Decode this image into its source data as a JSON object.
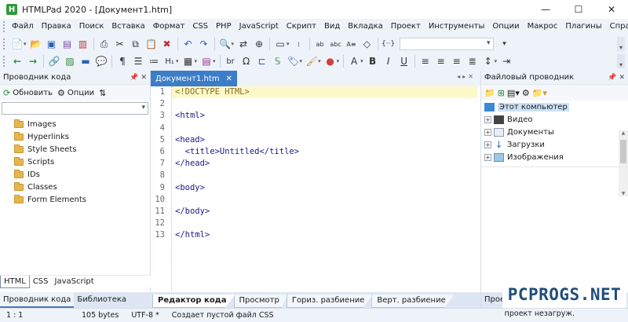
{
  "window": {
    "title": "HTMLPad 2020 - [Документ1.htm]",
    "buttons": {
      "minimize": "—",
      "maximize": "☐",
      "close": "✕"
    }
  },
  "menu": [
    "Файл",
    "Правка",
    "Поиск",
    "Вставка",
    "Формат",
    "CSS",
    "PHP",
    "JavaScript",
    "Скрипт",
    "Вид",
    "Вкладка",
    "Проект",
    "Инструменты",
    "Опции",
    "Макрос",
    "Плагины",
    "Справка"
  ],
  "toolbar1_icons": [
    "new-file-icon",
    "open-icon",
    "save-icon",
    "print-icon",
    "cut-icon",
    "copy-icon",
    "paste-icon",
    "undo-icon",
    "redo-icon",
    "find-icon",
    "replace-icon",
    "zoom-icon",
    "spell-icon",
    "format-icon",
    "snippet-icon"
  ],
  "toolbar2_icons": [
    "back-icon",
    "forward-icon",
    "link-icon",
    "image-icon",
    "rule-icon",
    "comment-icon",
    "paragraph-icon",
    "list-icon",
    "numbered-list-icon",
    "heading-icon",
    "table-icon",
    "form-icon",
    "break-icon",
    "omega-icon",
    "script-icon",
    "tag-icon",
    "brush-icon",
    "color-icon",
    "font-color-icon",
    "bold-icon",
    "italic-icon",
    "underline-icon",
    "align-left-icon",
    "align-center-icon",
    "align-right-icon",
    "justify-icon",
    "line-height-icon",
    "indent-icon"
  ],
  "left_panel": {
    "title": "Проводник кода",
    "refresh_label": "Обновить",
    "options_label": "Опции",
    "search_placeholder": "",
    "items": [
      "Images",
      "Hyperlinks",
      "Style Sheets",
      "Scripts",
      "IDs",
      "Classes",
      "Form Elements"
    ],
    "lang_tabs": [
      "HTML",
      "CSS",
      "JavaScript"
    ],
    "active_lang_tab": "HTML",
    "panel_tabs": [
      "Проводник кода",
      "Библиотека"
    ]
  },
  "editor": {
    "tab_title": "Документ1.htm",
    "close_glyph": "✕",
    "line_numbers": [
      "1",
      "2",
      "3",
      "4",
      "5",
      "6",
      "7",
      "8",
      "9",
      "10",
      "11",
      "12",
      "13"
    ],
    "lines": [
      "<!DOCTYPE HTML>",
      "",
      "<html>",
      "",
      "<head>",
      "  <title>Untitled</title>",
      "</head>",
      "",
      "<body>",
      "",
      "</body>",
      "",
      "</html>"
    ],
    "bottom_tabs": [
      "Редактор кода",
      "Просмотр",
      "Гориз. разбиение",
      "Верт. разбиение"
    ],
    "active_bottom_tab": "Редактор кода"
  },
  "right_panel": {
    "title": "Файловый проводник",
    "root": "Этот компьютер",
    "items": [
      "Видео",
      "Документы",
      "Загрузки",
      "Изображения"
    ],
    "bottom_text": "Прое"
  },
  "status": {
    "position": "1 : 1",
    "size": "105 bytes",
    "encoding": "UTF-8 *",
    "message": "Создает пустой файл CSS",
    "project": "проект незагруж."
  },
  "watermark": "PCPROGS.NET"
}
